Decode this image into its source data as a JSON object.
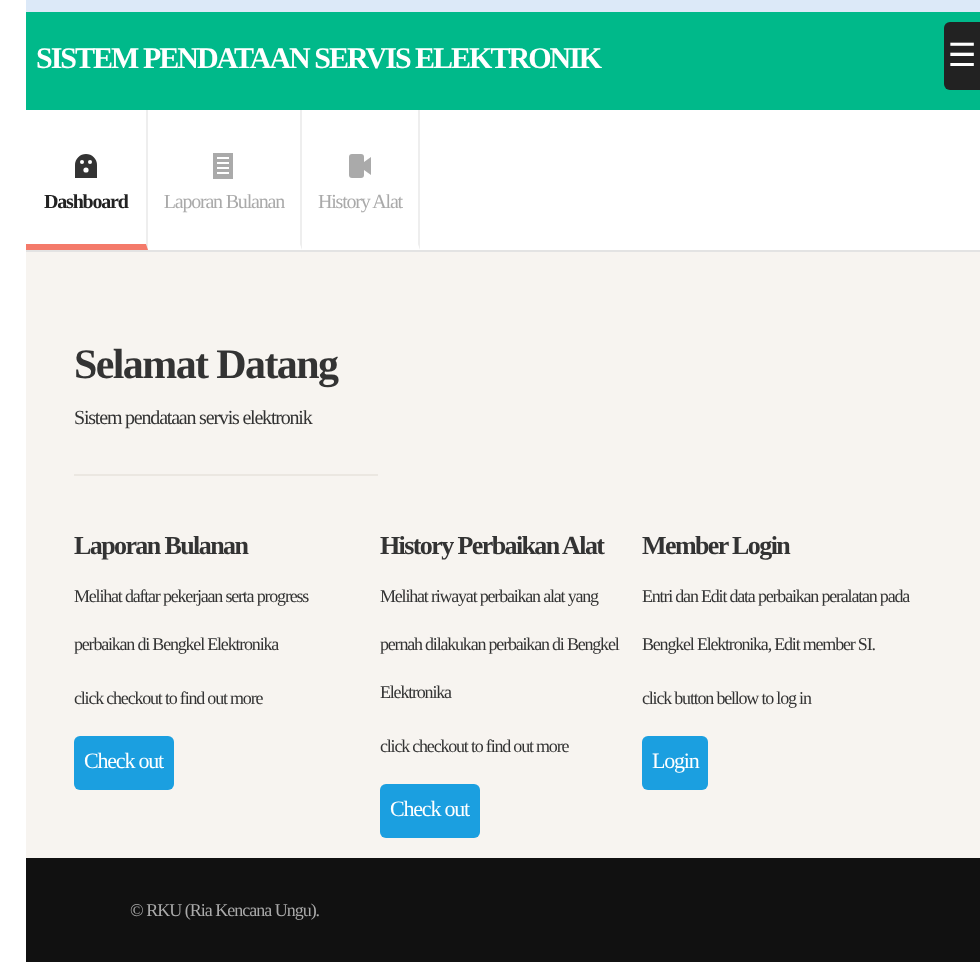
{
  "header": {
    "title": "SISTEM PENDATAAN SERVIS ELEKTRONIK",
    "menu_icon": "☰"
  },
  "tabs": [
    {
      "label": "Dashboard",
      "kind": "dashboard",
      "selected": true
    },
    {
      "label": "Laporan Bulanan",
      "kind": "report",
      "selected": false
    },
    {
      "label": "History Alat",
      "kind": "history",
      "selected": false
    }
  ],
  "welcome": {
    "title": "Selamat Datang",
    "subtitle": "Sistem pendataan servis elektronik"
  },
  "features": [
    {
      "title": "Laporan Bulanan",
      "description": "Melihat daftar pekerjaan serta progress perbaikan di Bengkel Elektronika",
      "hint": "click checkout to find out more",
      "button": "Check out"
    },
    {
      "title": "History Perbaikan Alat",
      "description": "Melihat riwayat perbaikan alat yang pernah dilakukan perbaikan di Bengkel Elektronika",
      "hint": "click checkout to find out more",
      "button": "Check out"
    },
    {
      "title": "Member Login",
      "description": "Entri dan Edit data perbaikan peralatan pada Bengkel Elektronika, Edit member SI.",
      "hint": "click button bellow to log in",
      "button": "Login"
    }
  ],
  "footer": {
    "text": "© RKU (Ria Kencana Ungu)."
  }
}
